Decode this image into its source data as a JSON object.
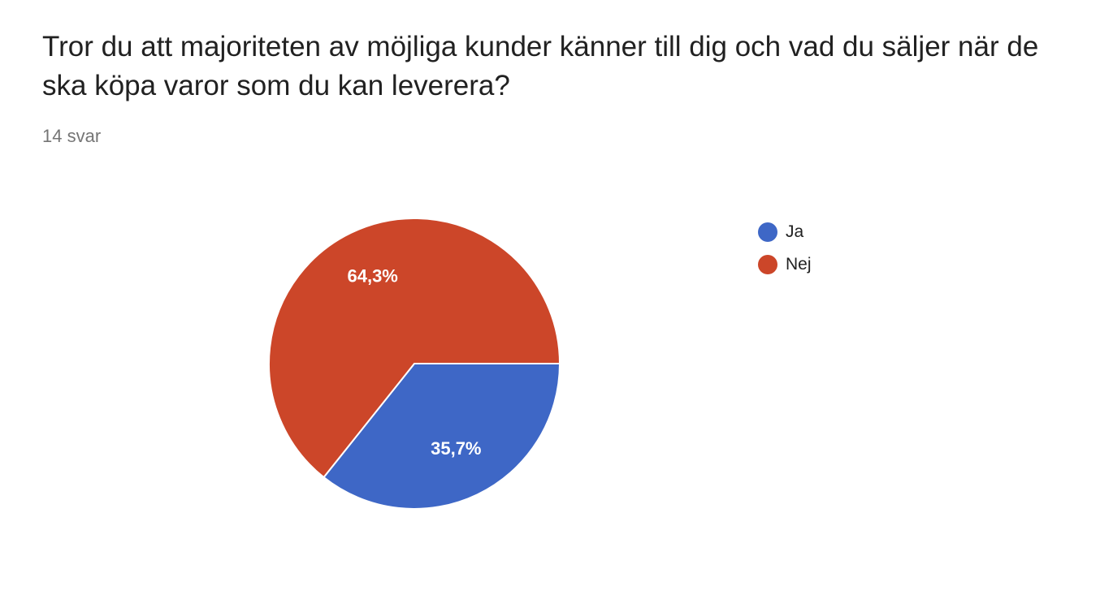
{
  "header": {
    "question": "Tror du att majoriteten av möjliga kunder känner till dig och vad du säljer när de ska köpa varor som du kan leverera?",
    "response_count": "14 svar"
  },
  "chart_data": {
    "type": "pie",
    "title": "Tror du att majoriteten av möjliga kunder känner till dig och vad du säljer när de ska köpa varor som du kan leverera?",
    "categories": [
      "Ja",
      "Nej"
    ],
    "values": [
      35.7,
      64.3
    ],
    "value_labels": [
      "35,7%",
      "64,3%"
    ],
    "colors": [
      "#3e67c6",
      "#cc4629"
    ],
    "legend_position": "right"
  },
  "legend": {
    "items": [
      {
        "label": "Ja",
        "color": "#3e67c6"
      },
      {
        "label": "Nej",
        "color": "#cc4629"
      }
    ]
  }
}
